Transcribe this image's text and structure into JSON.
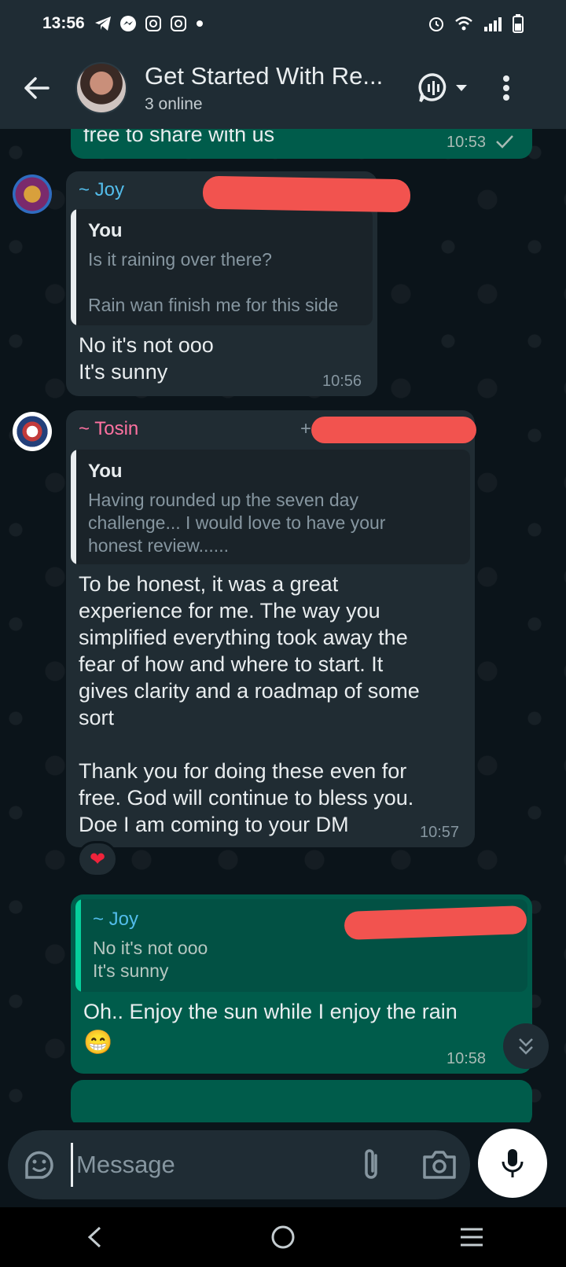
{
  "status_bar": {
    "time": "13:56",
    "notification_icons": [
      "telegram-icon",
      "messenger-icon",
      "instagram-icon",
      "instagram-icon",
      "dot-icon"
    ],
    "right_icons": [
      "alarm-icon",
      "wifi-icon",
      "signal-icon",
      "battery-icon"
    ]
  },
  "header": {
    "title": "Get Started With Re...",
    "subtitle": "3 online",
    "icons": [
      "back-arrow-icon",
      "voice-chat-icon",
      "chevron-down-icon",
      "more-vertical-icon"
    ]
  },
  "messages": {
    "m0": {
      "text": "free to share with us",
      "time": "10:53",
      "status": "sent-check-icon"
    },
    "m1": {
      "sender": "~ Joy",
      "quote_name": "You",
      "quote_text": "Is it raining over there?\n\nRain wan finish me for this side",
      "text": "No it's not ooo\nIt's sunny",
      "time": "10:56"
    },
    "m2": {
      "sender": "~ Tosin",
      "phone_prefix": "+",
      "quote_name": "You",
      "quote_text": "Having rounded up the seven day\nchallenge... I would love to have your\nhonest review......",
      "text": "To be honest, it was a great\nexperience for me. The way you\nsimplified everything took away the\nfear of how and where to start. It\ngives clarity and a roadmap of some\nsort\n\nThank you for doing these even for\nfree. God will continue to bless you.\nDoe I am coming to your DM",
      "time": "10:57",
      "reaction": "❤"
    },
    "m3": {
      "quote_name": "~ Joy",
      "quote_text": "No it's not ooo\nIt's sunny",
      "text": "Oh.. Enjoy the sun while I enjoy the rain",
      "emoji": "😁",
      "time": "10:58"
    }
  },
  "composer": {
    "placeholder": "Message",
    "icons": [
      "sticker-icon",
      "paperclip-icon",
      "camera-icon",
      "microphone-icon"
    ]
  },
  "nav": {
    "icons": [
      "nav-back-icon",
      "nav-home-icon",
      "nav-recents-icon"
    ]
  },
  "colors": {
    "header_bg": "#1f2c34",
    "chat_bg": "#0b141a",
    "incoming_bubble": "#202c33",
    "outgoing_bubble": "#005c4b",
    "joy_name": "#53bdeb",
    "tosin_name": "#ff72a1",
    "redaction": "#f2534f"
  }
}
